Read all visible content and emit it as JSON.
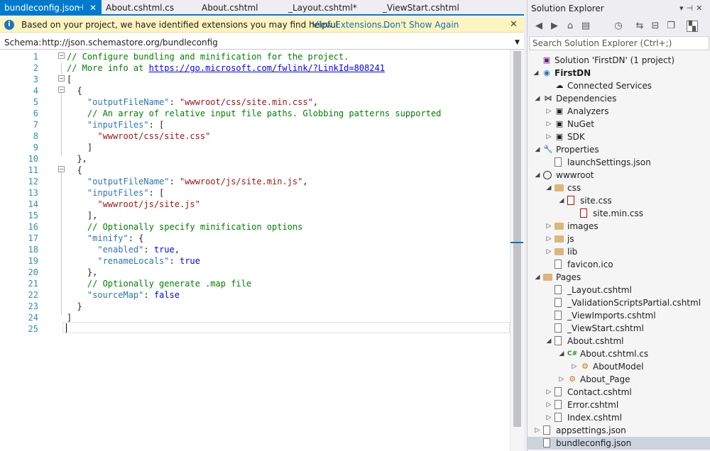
{
  "tabs": [
    {
      "label": "bundleconfig.json",
      "active": true
    },
    {
      "label": "About.cshtml.cs",
      "active": false
    },
    {
      "label": "About.cshtml",
      "active": false
    },
    {
      "label": "_Layout.cshtml*",
      "active": false
    },
    {
      "label": "_ViewStart.cshtml",
      "active": false
    }
  ],
  "infobar": {
    "message": "Based on your project, we have identified extensions you may find helpful",
    "view_extensions": "View Extensions...",
    "dont_show": "Don't Show Again"
  },
  "schema": {
    "label": "Schema:",
    "value": "http://json.schemastore.org/bundleconfig"
  },
  "code_lines": [
    "// Configure bundling and minification for the project.",
    "// More info at https://go.microsoft.com/fwlink/?LinkId=808241",
    "[",
    "  {",
    "    \"outputFileName\": \"wwwroot/css/site.min.css\",",
    "    // An array of relative input file paths. Globbing patterns supported",
    "    \"inputFiles\": [",
    "      \"wwwroot/css/site.css\"",
    "    ]",
    "  },",
    "  {",
    "    \"outputFileName\": \"wwwroot/js/site.min.js\",",
    "    \"inputFiles\": [",
    "      \"wwwroot/js/site.js\"",
    "    ],",
    "    // Optionally specify minification options",
    "    \"minify\": {",
    "      \"enabled\": true,",
    "      \"renameLocals\": true",
    "    },",
    "    // Optionally generate .map file",
    "    \"sourceMap\": false",
    "  }",
    "]",
    ""
  ],
  "solution_explorer": {
    "title": "Solution Explorer",
    "search_placeholder": "Search Solution Explorer (Ctrl+;)",
    "items": [
      {
        "label": "Solution 'FirstDN' (1 project)",
        "icon": "solution-icon"
      },
      {
        "label": "FirstDN",
        "icon": "project-icon",
        "bold": true
      },
      {
        "label": "Connected Services",
        "icon": "cloud-icon"
      },
      {
        "label": "Dependencies",
        "icon": "dependencies-icon"
      },
      {
        "label": "Analyzers",
        "icon": "analyzer-icon"
      },
      {
        "label": "NuGet",
        "icon": "nuget-icon"
      },
      {
        "label": "SDK",
        "icon": "sdk-icon"
      },
      {
        "label": "Properties",
        "icon": "wrench-icon"
      },
      {
        "label": "launchSettings.json",
        "icon": "json-file-icon"
      },
      {
        "label": "wwwroot",
        "icon": "globe-icon"
      },
      {
        "label": "css",
        "icon": "folder-icon"
      },
      {
        "label": "site.css",
        "icon": "css-file-icon"
      },
      {
        "label": "site.min.css",
        "icon": "css-file-icon"
      },
      {
        "label": "images",
        "icon": "folder-icon"
      },
      {
        "label": "js",
        "icon": "folder-icon"
      },
      {
        "label": "lib",
        "icon": "folder-icon"
      },
      {
        "label": "favicon.ico",
        "icon": "image-file-icon"
      },
      {
        "label": "Pages",
        "icon": "folder-icon"
      },
      {
        "label": "_Layout.cshtml",
        "icon": "cshtml-file-icon"
      },
      {
        "label": "_ValidationScriptsPartial.cshtml",
        "icon": "cshtml-file-icon"
      },
      {
        "label": "_ViewImports.cshtml",
        "icon": "cshtml-file-icon"
      },
      {
        "label": "_ViewStart.cshtml",
        "icon": "cshtml-file-icon"
      },
      {
        "label": "About.cshtml",
        "icon": "cshtml-file-icon"
      },
      {
        "label": "About.cshtml.cs",
        "icon": "csharp-file-icon"
      },
      {
        "label": "AboutModel",
        "icon": "class-icon"
      },
      {
        "label": "About_Page",
        "icon": "class-icon"
      },
      {
        "label": "Contact.cshtml",
        "icon": "cshtml-file-icon"
      },
      {
        "label": "Error.cshtml",
        "icon": "cshtml-file-icon"
      },
      {
        "label": "Index.cshtml",
        "icon": "cshtml-file-icon"
      },
      {
        "label": "appsettings.json",
        "icon": "json-file-icon"
      },
      {
        "label": "bundleconfig.json",
        "icon": "json-file-icon",
        "selected": true
      }
    ]
  },
  "colors": {
    "accent": "#007acc",
    "comment": "#008000",
    "string": "#a31515",
    "key": "#2e75b6",
    "keyword": "#0000ff"
  }
}
